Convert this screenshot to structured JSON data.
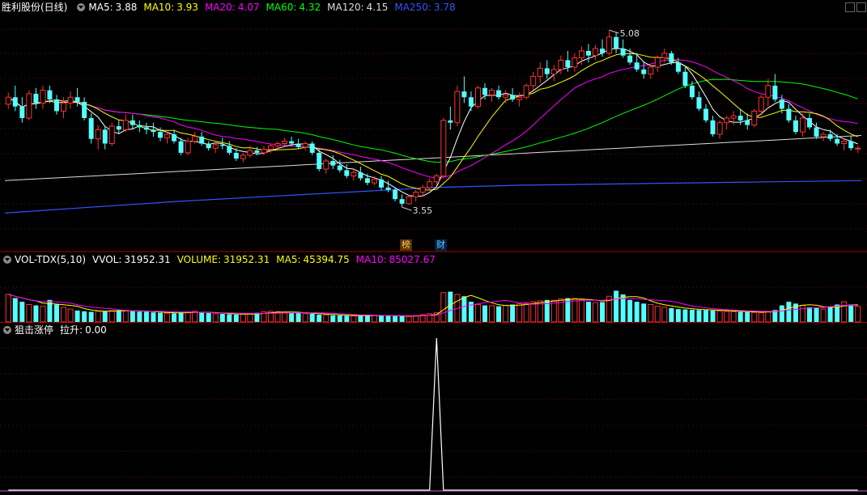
{
  "stock_name": "胜利股份(日线)",
  "price_panel": {
    "ma": [
      {
        "label": "MA5:",
        "value": "3.88",
        "color": "#ffffff"
      },
      {
        "label": "MA10:",
        "value": "3.93",
        "color": "#ffff00"
      },
      {
        "label": "MA20:",
        "value": "4.07",
        "color": "#ff00ff"
      },
      {
        "label": "MA60:",
        "value": "4.32",
        "color": "#00ff00"
      },
      {
        "label": "MA120:",
        "value": "4.15",
        "color": "#dddddd"
      },
      {
        "label": "MA250:",
        "value": "3.78",
        "color": "#3355ff"
      }
    ],
    "high_label": "5.08",
    "low_label": "3.55"
  },
  "badges": [
    {
      "text": "榜",
      "color": "#ffcc66",
      "bg": "#553300"
    },
    {
      "text": "财",
      "color": "#66ccff",
      "bg": "#002244"
    }
  ],
  "volume_panel": {
    "title": "VOL-TDX(5,10)",
    "items": [
      {
        "label": "VVOL:",
        "value": "31952.31",
        "color": "#ffffff"
      },
      {
        "label": "VOLUME:",
        "value": "31952.31",
        "color": "#ffff00"
      },
      {
        "label": "MA5:",
        "value": "45394.75",
        "color": "#ffff00"
      },
      {
        "label": "MA10:",
        "value": "85027.67",
        "color": "#ff00ff"
      }
    ]
  },
  "indicator_panel": {
    "title": "狙击涨停",
    "items": [
      {
        "label": "拉升:",
        "value": "0.00",
        "color": "#ffffff"
      }
    ]
  },
  "colors": {
    "up": "#ff3333",
    "down": "#54ffff",
    "divider": "#b00000",
    "grid": "#800000"
  },
  "chart_data": [
    {
      "type": "candlestick",
      "title": "胜利股份(日线)",
      "ylim": [
        3.3,
        5.2
      ],
      "high": 5.08,
      "low": 3.55,
      "ohlc": [
        [
          4.44,
          4.54,
          4.4,
          4.5
        ],
        [
          4.5,
          4.6,
          4.38,
          4.42
        ],
        [
          4.42,
          4.5,
          4.28,
          4.32
        ],
        [
          4.32,
          4.56,
          4.3,
          4.53
        ],
        [
          4.53,
          4.58,
          4.4,
          4.45
        ],
        [
          4.45,
          4.6,
          4.4,
          4.56
        ],
        [
          4.56,
          4.6,
          4.45,
          4.48
        ],
        [
          4.48,
          4.52,
          4.35,
          4.38
        ],
        [
          4.38,
          4.5,
          4.32,
          4.45
        ],
        [
          4.45,
          4.55,
          4.4,
          4.5
        ],
        [
          4.5,
          4.58,
          4.42,
          4.46
        ],
        [
          4.46,
          4.5,
          4.3,
          4.32
        ],
        [
          4.32,
          4.36,
          4.1,
          4.14
        ],
        [
          4.14,
          4.26,
          4.05,
          4.22
        ],
        [
          4.22,
          4.25,
          4.05,
          4.1
        ],
        [
          4.1,
          4.28,
          4.08,
          4.25
        ],
        [
          4.25,
          4.3,
          4.18,
          4.22
        ],
        [
          4.22,
          4.35,
          4.2,
          4.3
        ],
        [
          4.3,
          4.35,
          4.22,
          4.26
        ],
        [
          4.26,
          4.3,
          4.2,
          4.24
        ],
        [
          4.24,
          4.28,
          4.18,
          4.22
        ],
        [
          4.22,
          4.28,
          4.16,
          4.2
        ],
        [
          4.2,
          4.24,
          4.12,
          4.15
        ],
        [
          4.15,
          4.2,
          4.1,
          4.18
        ],
        [
          4.18,
          4.22,
          4.1,
          4.12
        ],
        [
          4.12,
          4.15,
          4.0,
          4.02
        ],
        [
          4.02,
          4.15,
          4.0,
          4.12
        ],
        [
          4.12,
          4.2,
          4.1,
          4.16
        ],
        [
          4.16,
          4.2,
          4.08,
          4.1
        ],
        [
          4.1,
          4.12,
          4.04,
          4.06
        ],
        [
          4.06,
          4.12,
          4.02,
          4.09
        ],
        [
          4.09,
          4.15,
          4.05,
          4.08
        ],
        [
          4.08,
          4.12,
          4.0,
          4.02
        ],
        [
          4.02,
          4.06,
          3.95,
          3.97
        ],
        [
          3.97,
          4.02,
          3.94,
          4.0
        ],
        [
          4.0,
          4.08,
          3.98,
          4.04
        ],
        [
          4.04,
          4.07,
          4.0,
          4.02
        ],
        [
          4.02,
          4.08,
          4.0,
          4.05
        ],
        [
          4.05,
          4.1,
          4.02,
          4.08
        ],
        [
          4.08,
          4.12,
          4.05,
          4.1
        ],
        [
          4.1,
          4.15,
          4.08,
          4.12
        ],
        [
          4.12,
          4.16,
          4.08,
          4.1
        ],
        [
          4.1,
          4.14,
          4.05,
          4.07
        ],
        [
          4.07,
          4.12,
          4.04,
          4.1
        ],
        [
          4.1,
          4.12,
          4.0,
          4.02
        ],
        [
          4.02,
          4.05,
          3.86,
          3.88
        ],
        [
          3.88,
          3.97,
          3.84,
          3.95
        ],
        [
          3.95,
          4.0,
          3.88,
          3.91
        ],
        [
          3.91,
          3.96,
          3.85,
          3.87
        ],
        [
          3.87,
          3.92,
          3.8,
          3.82
        ],
        [
          3.82,
          3.88,
          3.78,
          3.85
        ],
        [
          3.85,
          3.9,
          3.78,
          3.8
        ],
        [
          3.8,
          3.84,
          3.74,
          3.76
        ],
        [
          3.76,
          3.82,
          3.74,
          3.79
        ],
        [
          3.79,
          3.82,
          3.7,
          3.72
        ],
        [
          3.72,
          3.78,
          3.68,
          3.7
        ],
        [
          3.7,
          3.72,
          3.6,
          3.62
        ],
        [
          3.62,
          3.66,
          3.55,
          3.58
        ],
        [
          3.58,
          3.66,
          3.57,
          3.64
        ],
        [
          3.64,
          3.7,
          3.6,
          3.68
        ],
        [
          3.68,
          3.74,
          3.64,
          3.72
        ],
        [
          3.72,
          3.8,
          3.7,
          3.77
        ],
        [
          3.77,
          3.84,
          3.74,
          3.82
        ],
        [
          3.82,
          4.32,
          3.8,
          4.3
        ],
        [
          4.3,
          4.42,
          4.22,
          4.28
        ],
        [
          4.28,
          4.6,
          4.25,
          4.55
        ],
        [
          4.55,
          4.68,
          4.45,
          4.5
        ],
        [
          4.5,
          4.55,
          4.38,
          4.42
        ],
        [
          4.42,
          4.6,
          4.4,
          4.58
        ],
        [
          4.58,
          4.62,
          4.48,
          4.52
        ],
        [
          4.52,
          4.58,
          4.46,
          4.56
        ],
        [
          4.56,
          4.6,
          4.48,
          4.5
        ],
        [
          4.5,
          4.56,
          4.45,
          4.52
        ],
        [
          4.52,
          4.58,
          4.46,
          4.48
        ],
        [
          4.48,
          4.54,
          4.42,
          4.5
        ],
        [
          4.5,
          4.62,
          4.48,
          4.6
        ],
        [
          4.6,
          4.72,
          4.56,
          4.68
        ],
        [
          4.68,
          4.8,
          4.62,
          4.75
        ],
        [
          4.75,
          4.82,
          4.66,
          4.7
        ],
        [
          4.7,
          4.78,
          4.64,
          4.74
        ],
        [
          4.74,
          4.86,
          4.7,
          4.82
        ],
        [
          4.82,
          4.9,
          4.72,
          4.76
        ],
        [
          4.76,
          4.88,
          4.72,
          4.84
        ],
        [
          4.84,
          4.94,
          4.78,
          4.9
        ],
        [
          4.9,
          4.96,
          4.8,
          4.86
        ],
        [
          4.86,
          4.95,
          4.82,
          4.92
        ],
        [
          4.92,
          5.0,
          4.85,
          4.88
        ],
        [
          4.88,
          5.08,
          4.86,
          5.02
        ],
        [
          5.02,
          5.06,
          4.88,
          4.92
        ],
        [
          4.92,
          5.0,
          4.84,
          4.86
        ],
        [
          4.86,
          4.92,
          4.78,
          4.8
        ],
        [
          4.8,
          4.88,
          4.72,
          4.74
        ],
        [
          4.74,
          4.8,
          4.66,
          4.7
        ],
        [
          4.7,
          4.78,
          4.66,
          4.76
        ],
        [
          4.76,
          4.86,
          4.72,
          4.84
        ],
        [
          4.84,
          4.92,
          4.8,
          4.88
        ],
        [
          4.88,
          4.9,
          4.78,
          4.8
        ],
        [
          4.8,
          4.84,
          4.7,
          4.72
        ],
        [
          4.72,
          4.76,
          4.58,
          4.6
        ],
        [
          4.6,
          4.64,
          4.48,
          4.5
        ],
        [
          4.5,
          4.55,
          4.38,
          4.4
        ],
        [
          4.4,
          4.44,
          4.28,
          4.3
        ],
        [
          4.3,
          4.34,
          4.16,
          4.18
        ],
        [
          4.18,
          4.3,
          4.14,
          4.28
        ],
        [
          4.28,
          4.34,
          4.22,
          4.32
        ],
        [
          4.32,
          4.38,
          4.26,
          4.34
        ],
        [
          4.34,
          4.4,
          4.26,
          4.3
        ],
        [
          4.3,
          4.36,
          4.22,
          4.26
        ],
        [
          4.26,
          4.4,
          4.24,
          4.38
        ],
        [
          4.38,
          4.52,
          4.34,
          4.5
        ],
        [
          4.5,
          4.66,
          4.42,
          4.6
        ],
        [
          4.6,
          4.7,
          4.46,
          4.48
        ],
        [
          4.48,
          4.52,
          4.36,
          4.4
        ],
        [
          4.4,
          4.44,
          4.28,
          4.3
        ],
        [
          4.3,
          4.34,
          4.18,
          4.2
        ],
        [
          4.2,
          4.36,
          4.16,
          4.32
        ],
        [
          4.32,
          4.36,
          4.22,
          4.24
        ],
        [
          4.24,
          4.28,
          4.14,
          4.16
        ],
        [
          4.16,
          4.2,
          4.12,
          4.18
        ],
        [
          4.18,
          4.22,
          4.12,
          4.14
        ],
        [
          4.14,
          4.18,
          4.08,
          4.1
        ],
        [
          4.1,
          4.14,
          4.04,
          4.12
        ],
        [
          4.12,
          4.16,
          4.04,
          4.06
        ],
        [
          4.06,
          4.08,
          4.02,
          4.06
        ]
      ],
      "ma_series": [
        {
          "name": "MA5",
          "value": 3.88,
          "color": "#ffffff"
        },
        {
          "name": "MA10",
          "value": 3.93,
          "color": "#ffff00"
        },
        {
          "name": "MA20",
          "value": 4.07,
          "color": "#ff00ff"
        },
        {
          "name": "MA60",
          "value": 4.32,
          "color": "#00ff00"
        },
        {
          "name": "MA120",
          "value": 4.15,
          "color": "#dddddd"
        },
        {
          "name": "MA250",
          "value": 3.78,
          "color": "#3355ff"
        }
      ],
      "ma120_tail": [
        3.78,
        3.79,
        3.8,
        3.81,
        3.82,
        3.83,
        3.84,
        3.85,
        3.86,
        3.87,
        3.88,
        3.89,
        3.9,
        3.91,
        3.92,
        3.93,
        3.94,
        3.95,
        3.96,
        3.97,
        3.98,
        3.99,
        4.0,
        4.01,
        4.02,
        4.03,
        4.04,
        4.05,
        4.06,
        4.07,
        4.08,
        4.09,
        4.1,
        4.11,
        4.12,
        4.13,
        4.14,
        4.15,
        4.16,
        4.17
      ],
      "ma250_path": [
        3.5,
        3.55,
        3.6,
        3.64,
        3.68,
        3.72,
        3.74,
        3.75,
        3.76,
        3.77,
        3.78
      ]
    },
    {
      "type": "bar",
      "title": "VOL-TDX(5,10)",
      "ylim": [
        0,
        300000
      ],
      "values": [
        150000,
        130000,
        110000,
        95000,
        90000,
        85000,
        120000,
        95000,
        80000,
        70000,
        62000,
        58000,
        55000,
        58000,
        60000,
        62000,
        64000,
        60000,
        58000,
        56000,
        55000,
        52000,
        50000,
        48000,
        47000,
        52000,
        55000,
        58000,
        50000,
        48000,
        45000,
        44000,
        42000,
        40000,
        42000,
        45000,
        50000,
        55000,
        58000,
        56000,
        52000,
        50000,
        48000,
        45000,
        44000,
        40000,
        38000,
        36000,
        35000,
        34000,
        33000,
        35000,
        38000,
        36000,
        34000,
        33000,
        32000,
        31000,
        30000,
        35000,
        40000,
        45000,
        50000,
        160000,
        165000,
        150000,
        140000,
        110000,
        95000,
        90000,
        88000,
        85000,
        90000,
        95000,
        100000,
        105000,
        110000,
        115000,
        120000,
        118000,
        125000,
        130000,
        128000,
        120000,
        110000,
        105000,
        108000,
        140000,
        170000,
        150000,
        120000,
        110000,
        100000,
        95000,
        85000,
        80000,
        75000,
        70000,
        68000,
        66000,
        65000,
        64000,
        62000,
        60000,
        58000,
        56000,
        55000,
        54000,
        52000,
        50000,
        58000,
        65000,
        90000,
        110000,
        100000,
        90000,
        80000,
        75000,
        70000,
        85000,
        95000,
        110000,
        95000,
        85000,
        80000,
        75000,
        70000,
        65000,
        60000,
        55000,
        50000,
        45000,
        40000,
        35000,
        31952
      ]
    },
    {
      "type": "line",
      "title": "狙击涨停",
      "series": [
        {
          "name": "拉升",
          "values": [
            0,
            0,
            0,
            0,
            0,
            0,
            0,
            0,
            0,
            0,
            0,
            0,
            0,
            0,
            0,
            0,
            0,
            0,
            0,
            0,
            0,
            0,
            0,
            0,
            0,
            0,
            0,
            0,
            0,
            0,
            0,
            0,
            0,
            0,
            0,
            0,
            0,
            0,
            0,
            0,
            0,
            0,
            0,
            0,
            0,
            0,
            0,
            0,
            0,
            0,
            0,
            0,
            0,
            0,
            0,
            0,
            0,
            0,
            0,
            0,
            0,
            0,
            1,
            0,
            0,
            0,
            0,
            0,
            0,
            0,
            0,
            0,
            0,
            0,
            0,
            0,
            0,
            0,
            0,
            0,
            0,
            0,
            0,
            0,
            0,
            0,
            0,
            0,
            0,
            0,
            0,
            0,
            0,
            0,
            0,
            0,
            0,
            0,
            0,
            0,
            0,
            0,
            0,
            0,
            0,
            0,
            0,
            0,
            0,
            0,
            0,
            0,
            0,
            0,
            0,
            0,
            0,
            0,
            0,
            0,
            0,
            0,
            0,
            0,
            0,
            0,
            0,
            0,
            0,
            0,
            0,
            0,
            0,
            0,
            0
          ]
        }
      ]
    }
  ]
}
